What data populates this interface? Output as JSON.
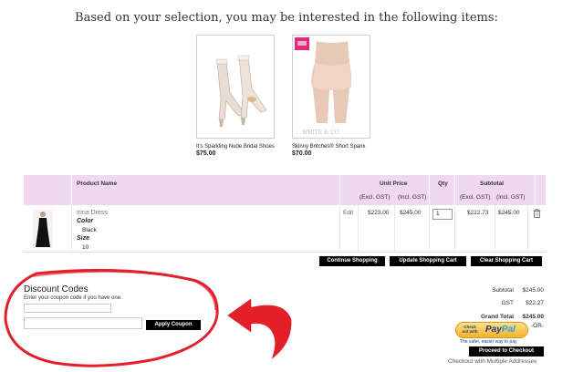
{
  "recommend": {
    "heading": "Based on your selection, you may be interested in the following items:",
    "products": [
      {
        "name": "It's Sparkling Nude Bridal Shoes",
        "price": "$75.00"
      },
      {
        "name": "Skinny Britches® Short Spanx",
        "price": "$70.00"
      }
    ]
  },
  "cart": {
    "headers": {
      "product_name": "Product Name",
      "unit_price": "Unit Price",
      "qty": "Qty",
      "subtotal": "Subtotal",
      "excl": "(Excl. GST)",
      "incl": "(Incl. GST)"
    },
    "item": {
      "name": "Irina Dress",
      "color_label": "Color",
      "color_value": "Black",
      "size_label": "Size",
      "size_value": "10",
      "edit": "Edit",
      "unit_excl": "$223.00",
      "unit_incl": "$245.00",
      "qty": "1",
      "sub_excl": "$222.73",
      "sub_incl": "$245.00"
    },
    "buttons": {
      "continue": "Continue Shopping",
      "update": "Update Shopping Cart",
      "clear": "Clear Shopping Cart"
    }
  },
  "discount": {
    "title": "Discount Codes",
    "hint": "Enter your coupon code if you have one.",
    "apply": "Apply Coupon"
  },
  "totals": {
    "subtotal_label": "Subtotal",
    "subtotal_value": "$245.00",
    "gst_label": "GST",
    "gst_value": "$22.27",
    "grand_label": "Grand Total",
    "grand_value": "$245.00",
    "paypal_small": "Check out with",
    "paypal_logo_a": "Pay",
    "paypal_logo_b": "Pal",
    "or": "-OR-",
    "paypal_tagline": "The safer, easier way to pay",
    "checkout": "Proceed to Checkout",
    "multi": "Checkout with Multiple Addresses"
  },
  "colors": {
    "header_bg": "#f0d9f0",
    "annotation_red": "#e3202a"
  }
}
